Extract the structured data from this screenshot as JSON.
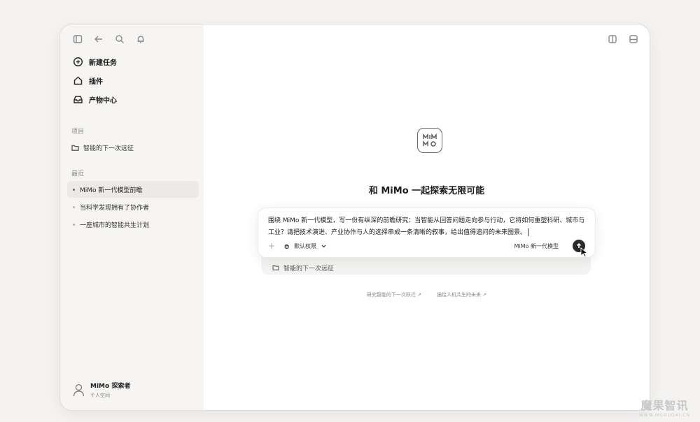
{
  "sidebar": {
    "nav": [
      {
        "label": "新建任务",
        "icon": "plus-circle-icon"
      },
      {
        "label": "插件",
        "icon": "puzzle-icon"
      },
      {
        "label": "产物中心",
        "icon": "inbox-icon"
      }
    ],
    "projects_title": "项目",
    "projects": [
      {
        "label": "智能的下一次远征",
        "icon": "folder-icon"
      }
    ],
    "recent_title": "最近",
    "recent": [
      {
        "label": "MiMo 新一代模型前瞻",
        "active": true
      },
      {
        "label": "当科学发现拥有了协作者",
        "active": false
      },
      {
        "label": "一座城市的智能共生计划",
        "active": false
      }
    ],
    "user": {
      "name": "MiMo 探索者",
      "subtitle": "个人空间"
    }
  },
  "main": {
    "headline": "和 MiMo 一起探索无限可能",
    "composer": {
      "text": "围绕 MiMo 新一代模型，写一份有纵深的前瞻研究：当智能从回答问题走向参与行动，它将如何重塑科研、城市与工业？请把技术演进、产业协作与人的选择串成一条清晰的叙事，给出值得追问的未来图景。",
      "plus": "+",
      "permission_label": "默认权限",
      "model_label": "MiMo 新一代模型"
    },
    "attached_project": "智能的下一次远征",
    "suggestions": [
      "研究智能的下一次跃迁 ↗",
      "描绘人机共生的未来 ↗"
    ]
  },
  "watermark": {
    "text": "魔果智讯",
    "sub": "WWW.MOGUOAI.CN"
  }
}
